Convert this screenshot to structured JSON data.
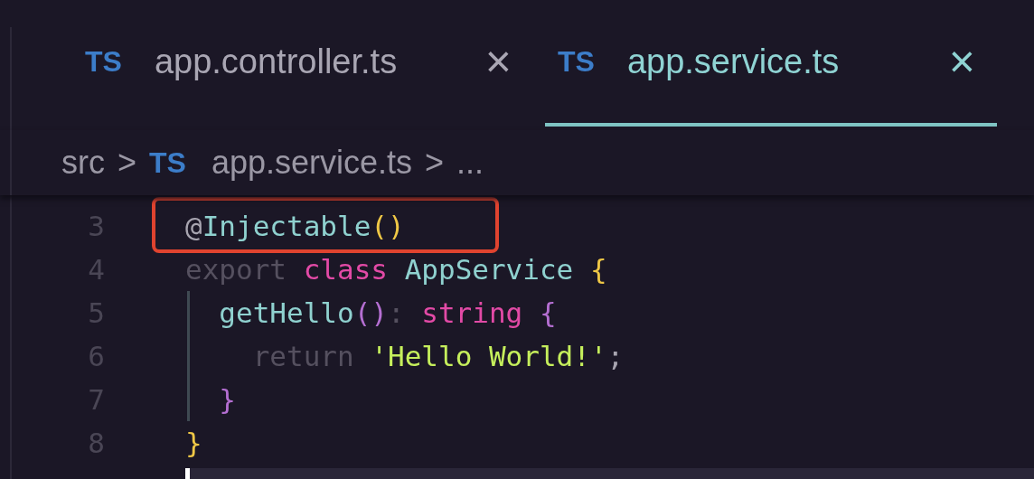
{
  "tabs": [
    {
      "icon": "TS",
      "label": "app.controller.ts",
      "close": "×",
      "selected": false
    },
    {
      "icon": "TS",
      "label": "app.service.ts",
      "close": "×",
      "selected": true
    }
  ],
  "breadcrumb": [
    {
      "kind": "text",
      "text": "src"
    },
    {
      "kind": "sep",
      "text": ">"
    },
    {
      "kind": "file",
      "icon": "TS",
      "text": "app.service.ts"
    },
    {
      "kind": "sep",
      "text": ">"
    },
    {
      "kind": "text",
      "text": "..."
    }
  ],
  "code": {
    "lines": [
      {
        "number": "3",
        "boxed": true,
        "guide": false,
        "tokens": [
          {
            "kind": "punct",
            "text": "@"
          },
          {
            "kind": "name",
            "text": "Injectable"
          },
          {
            "kind": "paren",
            "text": "()"
          }
        ]
      },
      {
        "number": "4",
        "boxed": false,
        "guide": false,
        "tokens": [
          {
            "kind": "dim",
            "text": "export "
          },
          {
            "kind": "keyword",
            "text": "class "
          },
          {
            "kind": "name",
            "text": "AppService "
          },
          {
            "kind": "paren",
            "text": "{"
          }
        ]
      },
      {
        "number": "5",
        "boxed": false,
        "guide": true,
        "tokens": [
          {
            "kind": "name",
            "text": "  getHello"
          },
          {
            "kind": "bracket",
            "text": "()"
          },
          {
            "kind": "dim",
            "text": ": "
          },
          {
            "kind": "keyword",
            "text": "string "
          },
          {
            "kind": "bracket",
            "text": "{"
          }
        ]
      },
      {
        "number": "6",
        "boxed": false,
        "guide": true,
        "tokens": [
          {
            "kind": "dim",
            "text": "    return "
          },
          {
            "kind": "string",
            "text": "'Hello World!'"
          },
          {
            "kind": "punct",
            "text": ";"
          }
        ]
      },
      {
        "number": "7",
        "boxed": false,
        "guide": true,
        "tokens": [
          {
            "kind": "bracket",
            "text": "  }"
          }
        ]
      },
      {
        "number": "8",
        "boxed": false,
        "guide": false,
        "tokens": [
          {
            "kind": "paren",
            "text": "}"
          }
        ]
      }
    ]
  }
}
